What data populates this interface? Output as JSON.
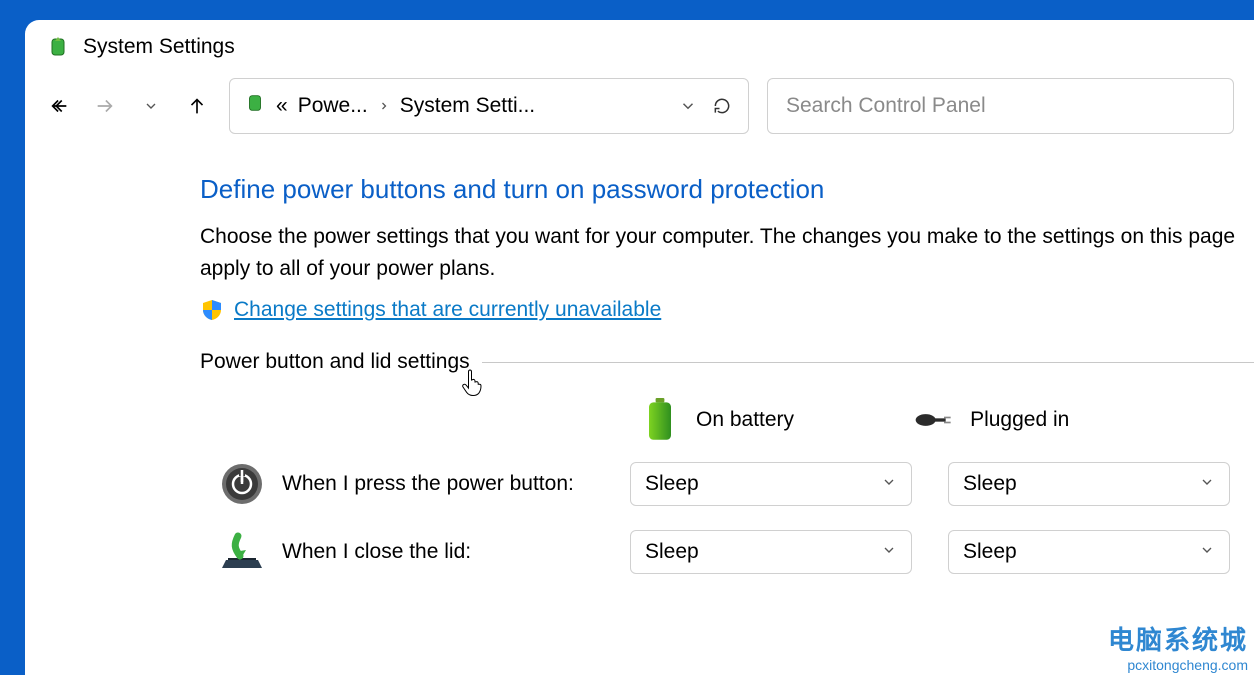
{
  "window": {
    "title": "System Settings"
  },
  "breadcrumb": {
    "ellipsis": "«",
    "part1": "Powe...",
    "part2": "System Setti..."
  },
  "search": {
    "placeholder": "Search Control Panel"
  },
  "main": {
    "heading": "Define power buttons and turn on password protection",
    "description": "Choose the power settings that you want for your computer. The changes you make to the settings on this page apply to all of your power plans.",
    "change_link": "Change settings that are currently unavailable",
    "section_label": "Power button and lid settings",
    "columns": {
      "battery": "On battery",
      "plugged": "Plugged in"
    },
    "rows": [
      {
        "label": "When I press the power button:",
        "battery_value": "Sleep",
        "plugged_value": "Sleep"
      },
      {
        "label": "When I close the lid:",
        "battery_value": "Sleep",
        "plugged_value": "Sleep"
      }
    ]
  },
  "watermark": {
    "line1": "电脑系统城",
    "line2": "pcxitongcheng.com"
  }
}
